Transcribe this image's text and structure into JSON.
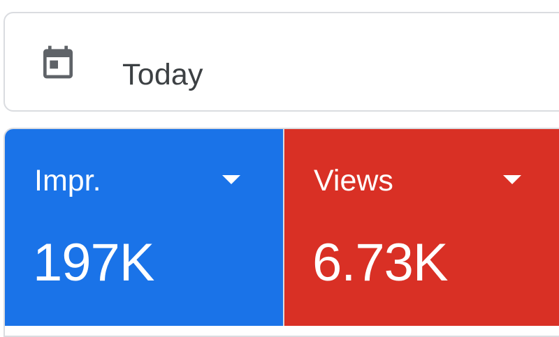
{
  "date_range": {
    "icon": "calendar-icon",
    "label": "Today"
  },
  "metrics": [
    {
      "title": "Impr.",
      "value": "197K",
      "color": "#1a73e8",
      "icon": "dropdown-caret-icon"
    },
    {
      "title": "Views",
      "value": "6.73K",
      "color": "#d93025",
      "icon": "dropdown-caret-icon"
    }
  ]
}
